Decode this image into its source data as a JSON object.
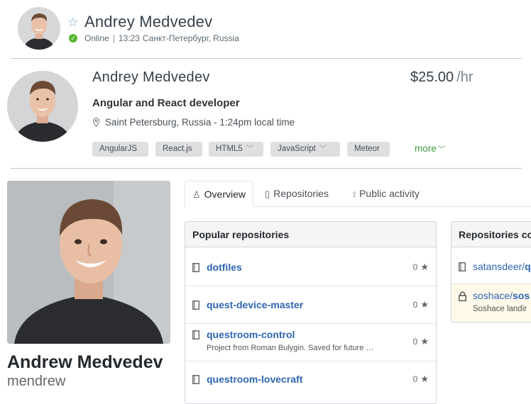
{
  "header": {
    "name": "Andrey Medvedev",
    "status": "Online",
    "local_time": "13:23",
    "location": "Санкт-Петербург, Russia"
  },
  "profile": {
    "name": "Andrey Medvedev",
    "rate": "$25.00",
    "rate_unit": "/hr",
    "title": "Angular and React developer",
    "location_time": "Saint Petersburg, Russia - 1:24pm local time",
    "skills": [
      "AngularJS",
      "React.js",
      "HTML5",
      "JavaScript",
      "Meteor"
    ],
    "more_label": "more"
  },
  "github": {
    "full_name": "Andrew Medvedev",
    "login": "mendrew",
    "tabs": [
      {
        "label": "Overview",
        "icon": "person-icon"
      },
      {
        "label": "Repositories",
        "icon": "repo-icon"
      },
      {
        "label": "Public activity",
        "icon": "rss-icon"
      }
    ],
    "popular": {
      "title": "Popular repositories",
      "repos": [
        {
          "name": "dotfiles",
          "description": "",
          "stars": "0"
        },
        {
          "name": "quest-device-master",
          "description": "",
          "stars": "0"
        },
        {
          "name": "questroom-control",
          "description": "Project from Roman Bulygin. Saved for future …",
          "stars": "0"
        },
        {
          "name": "questroom-lovecraft",
          "description": "",
          "stars": "0"
        }
      ]
    },
    "contributed": {
      "title": "Repositories co",
      "repos": [
        {
          "owner": "satansdeer/",
          "name": "q",
          "description": ""
        },
        {
          "owner": "soshace/",
          "name": "sos",
          "description": "Soshace landir"
        }
      ]
    }
  },
  "colors": {
    "link": "#2d66b1",
    "online": "#5ab532",
    "more": "#3d9c3a",
    "private_bg": "#fff9ea"
  }
}
